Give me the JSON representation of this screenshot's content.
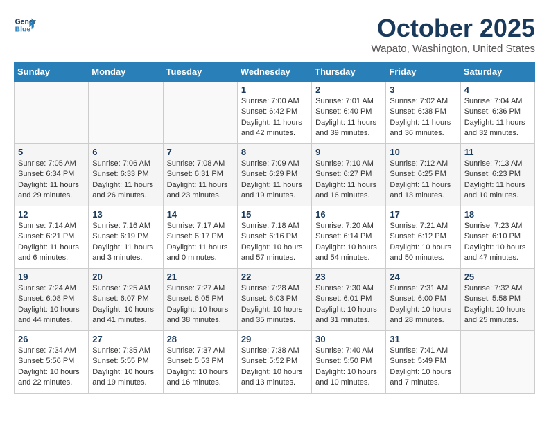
{
  "header": {
    "logo_line1": "General",
    "logo_line2": "Blue",
    "month_title": "October 2025",
    "location": "Wapato, Washington, United States"
  },
  "days_of_week": [
    "Sunday",
    "Monday",
    "Tuesday",
    "Wednesday",
    "Thursday",
    "Friday",
    "Saturday"
  ],
  "weeks": [
    [
      {
        "day": "",
        "info": ""
      },
      {
        "day": "",
        "info": ""
      },
      {
        "day": "",
        "info": ""
      },
      {
        "day": "1",
        "info": "Sunrise: 7:00 AM\nSunset: 6:42 PM\nDaylight: 11 hours\nand 42 minutes."
      },
      {
        "day": "2",
        "info": "Sunrise: 7:01 AM\nSunset: 6:40 PM\nDaylight: 11 hours\nand 39 minutes."
      },
      {
        "day": "3",
        "info": "Sunrise: 7:02 AM\nSunset: 6:38 PM\nDaylight: 11 hours\nand 36 minutes."
      },
      {
        "day": "4",
        "info": "Sunrise: 7:04 AM\nSunset: 6:36 PM\nDaylight: 11 hours\nand 32 minutes."
      }
    ],
    [
      {
        "day": "5",
        "info": "Sunrise: 7:05 AM\nSunset: 6:34 PM\nDaylight: 11 hours\nand 29 minutes."
      },
      {
        "day": "6",
        "info": "Sunrise: 7:06 AM\nSunset: 6:33 PM\nDaylight: 11 hours\nand 26 minutes."
      },
      {
        "day": "7",
        "info": "Sunrise: 7:08 AM\nSunset: 6:31 PM\nDaylight: 11 hours\nand 23 minutes."
      },
      {
        "day": "8",
        "info": "Sunrise: 7:09 AM\nSunset: 6:29 PM\nDaylight: 11 hours\nand 19 minutes."
      },
      {
        "day": "9",
        "info": "Sunrise: 7:10 AM\nSunset: 6:27 PM\nDaylight: 11 hours\nand 16 minutes."
      },
      {
        "day": "10",
        "info": "Sunrise: 7:12 AM\nSunset: 6:25 PM\nDaylight: 11 hours\nand 13 minutes."
      },
      {
        "day": "11",
        "info": "Sunrise: 7:13 AM\nSunset: 6:23 PM\nDaylight: 11 hours\nand 10 minutes."
      }
    ],
    [
      {
        "day": "12",
        "info": "Sunrise: 7:14 AM\nSunset: 6:21 PM\nDaylight: 11 hours\nand 6 minutes."
      },
      {
        "day": "13",
        "info": "Sunrise: 7:16 AM\nSunset: 6:19 PM\nDaylight: 11 hours\nand 3 minutes."
      },
      {
        "day": "14",
        "info": "Sunrise: 7:17 AM\nSunset: 6:17 PM\nDaylight: 11 hours\nand 0 minutes."
      },
      {
        "day": "15",
        "info": "Sunrise: 7:18 AM\nSunset: 6:16 PM\nDaylight: 10 hours\nand 57 minutes."
      },
      {
        "day": "16",
        "info": "Sunrise: 7:20 AM\nSunset: 6:14 PM\nDaylight: 10 hours\nand 54 minutes."
      },
      {
        "day": "17",
        "info": "Sunrise: 7:21 AM\nSunset: 6:12 PM\nDaylight: 10 hours\nand 50 minutes."
      },
      {
        "day": "18",
        "info": "Sunrise: 7:23 AM\nSunset: 6:10 PM\nDaylight: 10 hours\nand 47 minutes."
      }
    ],
    [
      {
        "day": "19",
        "info": "Sunrise: 7:24 AM\nSunset: 6:08 PM\nDaylight: 10 hours\nand 44 minutes."
      },
      {
        "day": "20",
        "info": "Sunrise: 7:25 AM\nSunset: 6:07 PM\nDaylight: 10 hours\nand 41 minutes."
      },
      {
        "day": "21",
        "info": "Sunrise: 7:27 AM\nSunset: 6:05 PM\nDaylight: 10 hours\nand 38 minutes."
      },
      {
        "day": "22",
        "info": "Sunrise: 7:28 AM\nSunset: 6:03 PM\nDaylight: 10 hours\nand 35 minutes."
      },
      {
        "day": "23",
        "info": "Sunrise: 7:30 AM\nSunset: 6:01 PM\nDaylight: 10 hours\nand 31 minutes."
      },
      {
        "day": "24",
        "info": "Sunrise: 7:31 AM\nSunset: 6:00 PM\nDaylight: 10 hours\nand 28 minutes."
      },
      {
        "day": "25",
        "info": "Sunrise: 7:32 AM\nSunset: 5:58 PM\nDaylight: 10 hours\nand 25 minutes."
      }
    ],
    [
      {
        "day": "26",
        "info": "Sunrise: 7:34 AM\nSunset: 5:56 PM\nDaylight: 10 hours\nand 22 minutes."
      },
      {
        "day": "27",
        "info": "Sunrise: 7:35 AM\nSunset: 5:55 PM\nDaylight: 10 hours\nand 19 minutes."
      },
      {
        "day": "28",
        "info": "Sunrise: 7:37 AM\nSunset: 5:53 PM\nDaylight: 10 hours\nand 16 minutes."
      },
      {
        "day": "29",
        "info": "Sunrise: 7:38 AM\nSunset: 5:52 PM\nDaylight: 10 hours\nand 13 minutes."
      },
      {
        "day": "30",
        "info": "Sunrise: 7:40 AM\nSunset: 5:50 PM\nDaylight: 10 hours\nand 10 minutes."
      },
      {
        "day": "31",
        "info": "Sunrise: 7:41 AM\nSunset: 5:49 PM\nDaylight: 10 hours\nand 7 minutes."
      },
      {
        "day": "",
        "info": ""
      }
    ]
  ]
}
